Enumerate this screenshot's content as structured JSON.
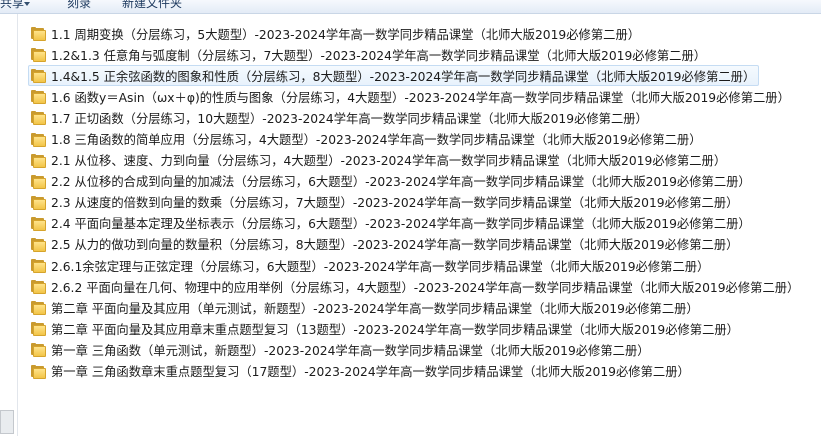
{
  "toolbar": {
    "share_label": "共享",
    "burn_label": "刻录",
    "new_folder_label": "新建文件夹"
  },
  "files": [
    {
      "name": "1.1 周期变换（分层练习，5大题型）-2023-2024学年高一数学同步精品课堂（北师大版2019必修第二册）"
    },
    {
      "name": "1.2&1.3 任意角与弧度制（分层练习，7大题型）-2023-2024学年高一数学同步精品课堂（北师大版2019必修第二册）"
    },
    {
      "name": "1.4&1.5 正余弦函数的图象和性质（分层练习，8大题型）-2023-2024学年高一数学同步精品课堂（北师大版2019必修第二册）"
    },
    {
      "name": "1.6 函数y＝Asin（ωx＋φ)的性质与图象（分层练习，4大题型）-2023-2024学年高一数学同步精品课堂（北师大版2019必修第二册）"
    },
    {
      "name": "1.7 正切函数（分层练习，10大题型）-2023-2024学年高一数学同步精品课堂（北师大版2019必修第二册）"
    },
    {
      "name": "1.8 三角函数的简单应用（分层练习，4大题型）-2023-2024学年高一数学同步精品课堂（北师大版2019必修第二册）"
    },
    {
      "name": "2.1 从位移、速度、力到向量（分层练习，4大题型）-2023-2024学年高一数学同步精品课堂（北师大版2019必修第二册）"
    },
    {
      "name": "2.2 从位移的合成到向量的加减法（分层练习，6大题型）-2023-2024学年高一数学同步精品课堂（北师大版2019必修第二册）"
    },
    {
      "name": "2.3 从速度的倍数到向量的数乘（分层练习，7大题型）-2023-2024学年高一数学同步精品课堂（北师大版2019必修第二册）"
    },
    {
      "name": "2.4 平面向量基本定理及坐标表示（分层练习，6大题型）-2023-2024学年高一数学同步精品课堂（北师大版2019必修第二册）"
    },
    {
      "name": "2.5 从力的做功到向量的数量积（分层练习，8大题型）-2023-2024学年高一数学同步精品课堂（北师大版2019必修第二册）"
    },
    {
      "name": "2.6.1余弦定理与正弦定理（分层练习，6大题型）-2023-2024学年高一数学同步精品课堂（北师大版2019必修第二册）"
    },
    {
      "name": "2.6.2 平面向量在几何、物理中的应用举例（分层练习，4大题型）-2023-2024学年高一数学同步精品课堂（北师大版2019必修第二册）"
    },
    {
      "name": "第二章 平面向量及其应用（单元测试，新题型）-2023-2024学年高一数学同步精品课堂（北师大版2019必修第二册）"
    },
    {
      "name": "第二章 平面向量及其应用章末重点题型复习（13题型）-2023-2024学年高一数学同步精品课堂（北师大版2019必修第二册）"
    },
    {
      "name": "第一章 三角函数（单元测试，新题型）-2023-2024学年高一数学同步精品课堂（北师大版2019必修第二册）"
    },
    {
      "name": "第一章 三角函数章末重点题型复习（17题型）-2023-2024学年高一数学同步精品课堂（北师大版2019必修第二册）"
    }
  ]
}
